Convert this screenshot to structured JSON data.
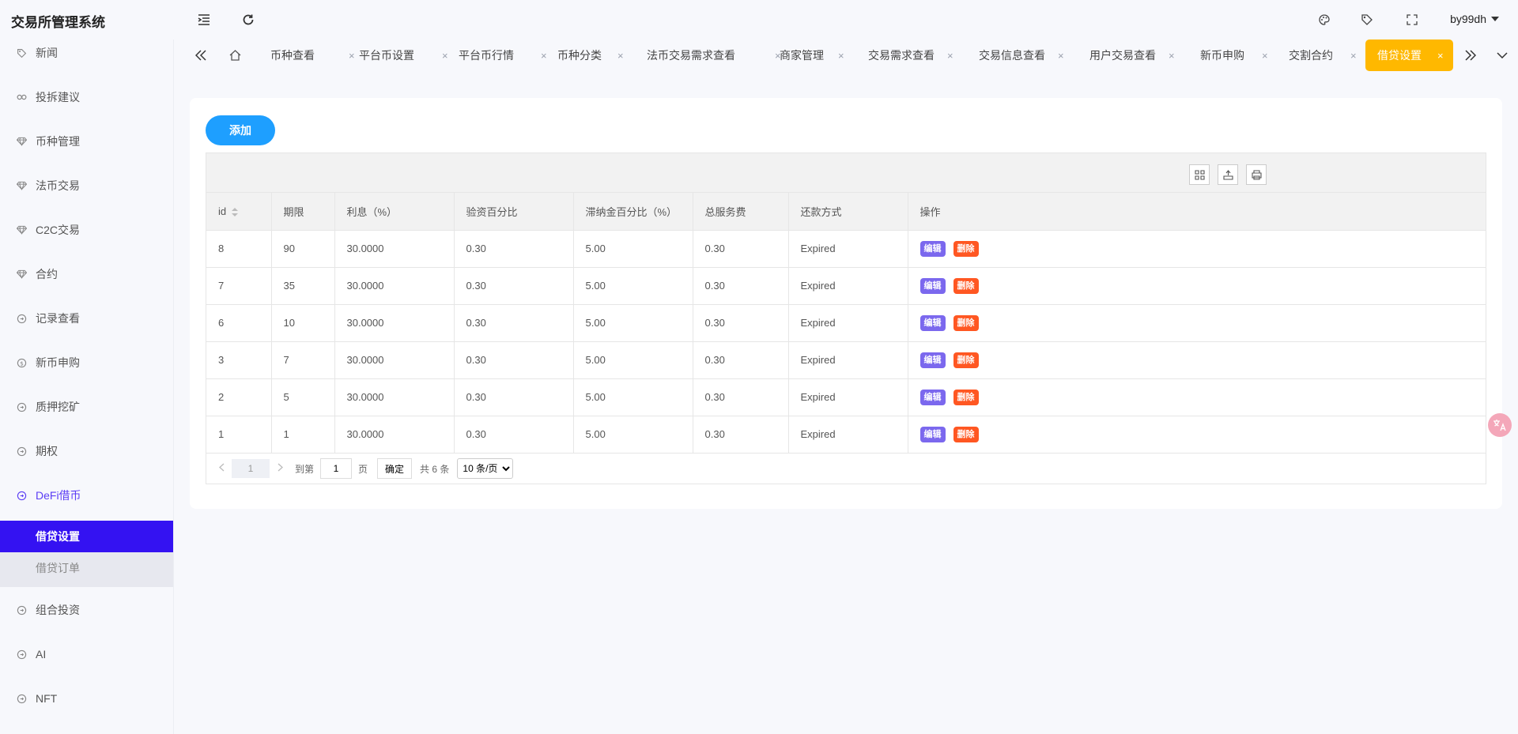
{
  "app": {
    "title": "交易所管理系统"
  },
  "header": {
    "username": "by99dh"
  },
  "sidebar": {
    "items": [
      {
        "label": "新闻",
        "icon": "tag-icon"
      },
      {
        "label": "投拆建议",
        "icon": "link-icon"
      },
      {
        "label": "币种管理",
        "icon": "diamond-icon"
      },
      {
        "label": "法币交易",
        "icon": "diamond-icon"
      },
      {
        "label": "C2C交易",
        "icon": "diamond-icon"
      },
      {
        "label": "合约",
        "icon": "diamond-icon"
      },
      {
        "label": "记录查看",
        "icon": "circle-arrow-icon"
      },
      {
        "label": "新币申购",
        "icon": "dollar-icon"
      },
      {
        "label": "质押挖矿",
        "icon": "circle-arrow-icon"
      },
      {
        "label": "期权",
        "icon": "circle-arrow-icon"
      },
      {
        "label": "DeFi借币",
        "icon": "circle-arrow-icon"
      },
      {
        "label": "组合投资",
        "icon": "circle-arrow-icon"
      },
      {
        "label": "AI",
        "icon": "circle-arrow-icon"
      },
      {
        "label": "NFT",
        "icon": "circle-arrow-icon"
      }
    ],
    "sub_items": [
      {
        "label": "借贷设置"
      },
      {
        "label": "借贷订单"
      }
    ]
  },
  "tabs": [
    {
      "label": "币种查看"
    },
    {
      "label": "平台币设置"
    },
    {
      "label": "平台币行情"
    },
    {
      "label": "币种分类"
    },
    {
      "label": "法币交易需求查看"
    },
    {
      "label": "商家管理"
    },
    {
      "label": "交易需求查看"
    },
    {
      "label": "交易信息查看"
    },
    {
      "label": "用户交易查看"
    },
    {
      "label": "新币申购"
    },
    {
      "label": "交割合约"
    },
    {
      "label": "借贷设置"
    }
  ],
  "tab_close": "×",
  "toolbar": {
    "add_label": "添加"
  },
  "table": {
    "columns": [
      "id",
      "期限",
      "利息（%）",
      "验资百分比",
      "滞纳金百分比（%）",
      "总服务费",
      "还款方式",
      "操作"
    ],
    "rows": [
      [
        "8",
        "90",
        "30.0000",
        "0.30",
        "5.00",
        "0.30",
        "Expired"
      ],
      [
        "7",
        "35",
        "30.0000",
        "0.30",
        "5.00",
        "0.30",
        "Expired"
      ],
      [
        "6",
        "10",
        "30.0000",
        "0.30",
        "5.00",
        "0.30",
        "Expired"
      ],
      [
        "3",
        "7",
        "30.0000",
        "0.30",
        "5.00",
        "0.30",
        "Expired"
      ],
      [
        "2",
        "5",
        "30.0000",
        "0.30",
        "5.00",
        "0.30",
        "Expired"
      ],
      [
        "1",
        "1",
        "30.0000",
        "0.30",
        "5.00",
        "0.30",
        "Expired"
      ]
    ],
    "edit_label": "编辑",
    "delete_label": "删除"
  },
  "pager": {
    "current": "1",
    "goto_prefix": "到第",
    "goto_value": "1",
    "goto_suffix": "页",
    "confirm": "确定",
    "total": "共 6 条",
    "page_size": "10 条/页"
  },
  "colors": {
    "accent": "#3412f2",
    "active_tab": "#ffb800",
    "add_button": "#1e9fff",
    "edit": "#7b68ee",
    "delete": "#ff5722"
  }
}
